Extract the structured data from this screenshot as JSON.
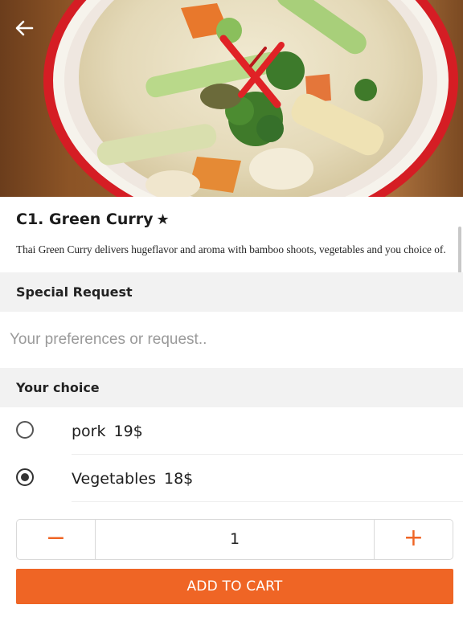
{
  "header": {
    "back_icon": "arrow-left-icon",
    "image_alt": "green curry dish photo"
  },
  "item": {
    "title": "C1. Green Curry",
    "star": "★",
    "description": "Thai Green Curry delivers hugeflavor and aroma with bamboo shoots, vegetables and you choice of."
  },
  "special_request": {
    "heading": "Special Request",
    "placeholder": "Your preferences or request.."
  },
  "choice": {
    "heading": "Your choice",
    "options": [
      {
        "label": "pork",
        "price": "19$",
        "selected": false
      },
      {
        "label": "Vegetables",
        "price": "18$",
        "selected": true
      }
    ]
  },
  "quantity": {
    "minus": "−",
    "value": "1",
    "plus": "+"
  },
  "cart": {
    "button_label": "ADD TO CART"
  },
  "colors": {
    "accent": "#ef6525",
    "section_bg": "#f2f2f2"
  }
}
